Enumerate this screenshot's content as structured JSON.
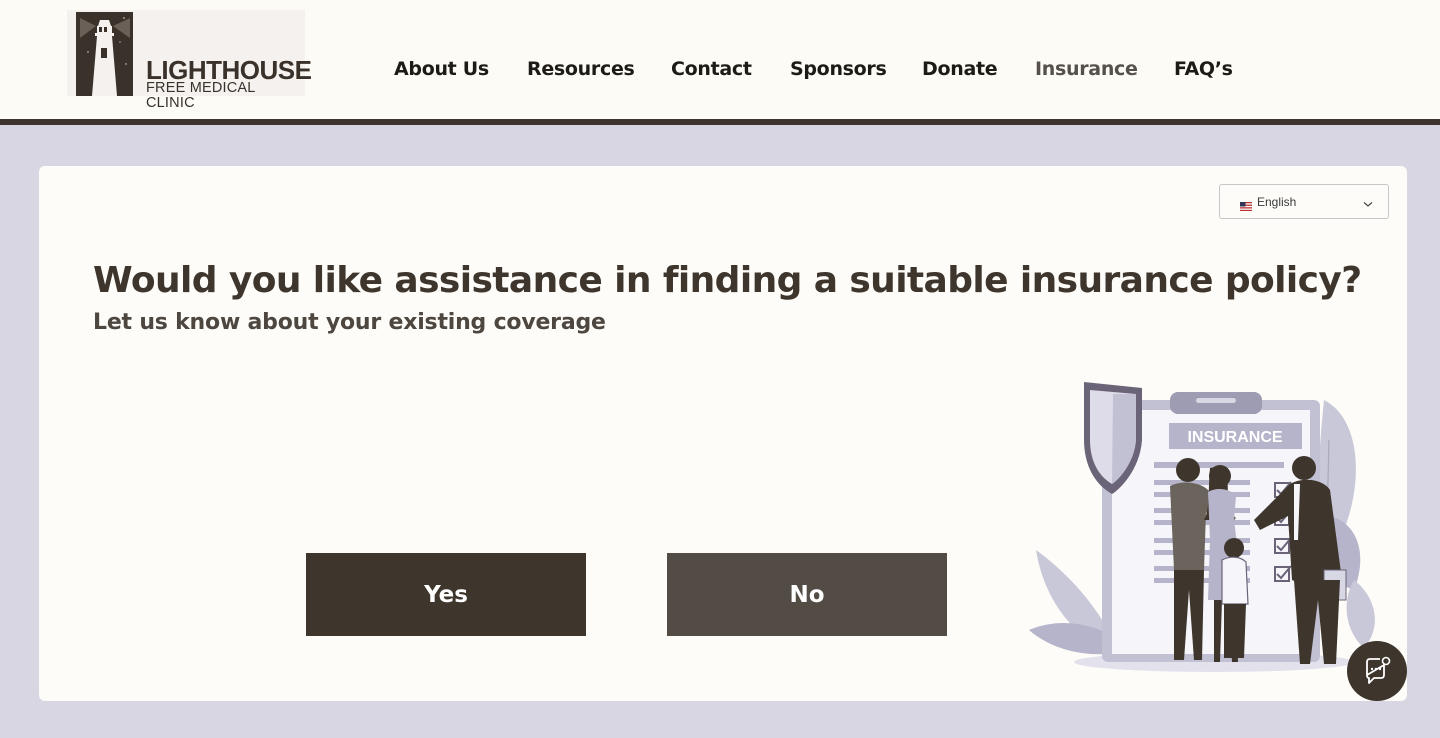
{
  "header": {
    "logo": {
      "title": "LIGHTHOUSE",
      "subtitle": "FREE MEDICAL CLINIC"
    },
    "nav": [
      {
        "label": "About Us"
      },
      {
        "label": "Resources"
      },
      {
        "label": "Contact"
      },
      {
        "label": "Sponsors"
      },
      {
        "label": "Donate"
      },
      {
        "label": "Insurance",
        "active": true
      },
      {
        "label": "FAQ’s"
      }
    ]
  },
  "language_select": {
    "selected": "English",
    "icon": "flag-icon"
  },
  "main": {
    "title": "Would you like assistance in finding a suitable insurance policy?",
    "subtitle": "Let us know about your existing coverage",
    "yes_label": "Yes",
    "no_label": "No",
    "illustration": {
      "icon": "insurance-illustration",
      "clipboard_label": "INSURANCE"
    }
  },
  "chat": {
    "icon": "chat-icon"
  },
  "colors": {
    "brand": "#3e362d",
    "button_secondary": "#534c44",
    "page_bg": "#d8d6e2",
    "card_bg": "#fdfcf9",
    "illustration_accent": "#b5b4ca"
  }
}
